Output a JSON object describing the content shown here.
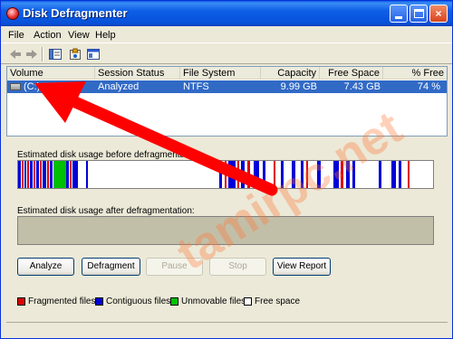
{
  "window": {
    "title": "Disk Defragmenter",
    "controls": {
      "minimize": "minimize",
      "maximize": "maximize",
      "close": "×"
    }
  },
  "menu": [
    "File",
    "Action",
    "View",
    "Help"
  ],
  "toolbar": {
    "icons": [
      "back-arrow-icon",
      "forward-arrow-icon",
      "properties-icon",
      "help-icon",
      "console-icon"
    ]
  },
  "volumes": {
    "columns": [
      "Volume",
      "Session Status",
      "File System",
      "Capacity",
      "Free Space",
      "% Free Space"
    ],
    "rows": [
      {
        "volume": "(C:)",
        "status": "Analyzed",
        "fs": "NTFS",
        "capacity": "9.99 GB",
        "free": "7.43 GB",
        "pct": "74 %"
      }
    ]
  },
  "before_label": "Estimated disk usage before defragmentation:",
  "after_label": "Estimated disk usage after defragmentation:",
  "buttons": {
    "analyze": "Analyze",
    "defragment": "Defragment",
    "pause": "Pause",
    "stop": "Stop",
    "report": "View Report"
  },
  "legend": {
    "fragmented": "Fragmented files",
    "contiguous": "Contiguous files",
    "unmovable": "Unmovable files",
    "free": "Free space"
  },
  "colors": {
    "fragmented": "#e00000",
    "contiguous": "#0000d8",
    "unmovable": "#00c000",
    "free": "#ffffff",
    "title_bar": "#0a5ce4",
    "selection": "#316ac5",
    "arrow": "#ff0000"
  },
  "watermark": "tamirpc.net"
}
